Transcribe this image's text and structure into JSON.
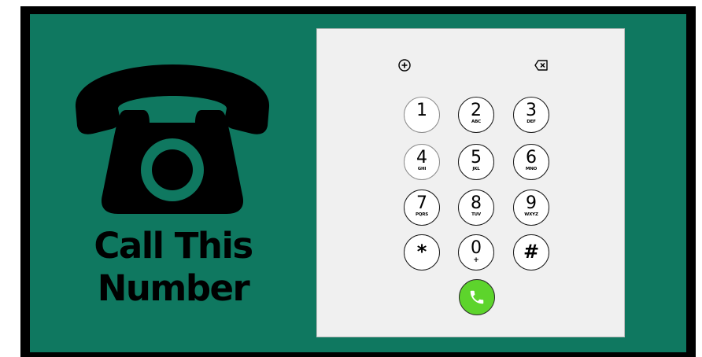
{
  "poster": {
    "headline_line1": "Call This",
    "headline_line2": "Number",
    "colors": {
      "background": "#0f7860",
      "border": "#000000",
      "call_button": "#5dd42c"
    },
    "icon": "rotary-telephone-icon"
  },
  "dialpad": {
    "top_left_icon": "add-contact-plus-icon",
    "top_right_icon": "backspace-delete-icon",
    "keys": [
      {
        "digit": "1",
        "letters": ""
      },
      {
        "digit": "2",
        "letters": "ABC"
      },
      {
        "digit": "3",
        "letters": "DEF"
      },
      {
        "digit": "4",
        "letters": "GHI"
      },
      {
        "digit": "5",
        "letters": "JKL"
      },
      {
        "digit": "6",
        "letters": "MNO"
      },
      {
        "digit": "7",
        "letters": "PQRS"
      },
      {
        "digit": "8",
        "letters": "TUV"
      },
      {
        "digit": "9",
        "letters": "WXYZ"
      },
      {
        "digit": "*",
        "letters": ""
      },
      {
        "digit": "0",
        "letters": "+"
      },
      {
        "digit": "#",
        "letters": ""
      }
    ],
    "call_icon": "phone-handset-icon"
  }
}
